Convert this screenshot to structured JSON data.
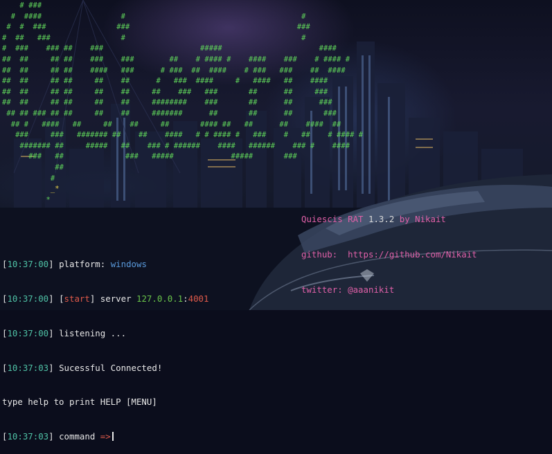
{
  "ascii_art": [
    "    # ###",
    "  #  ####                  #                                        #",
    " #  #  ###                ###                                      ###",
    "#  ##   ###                #                                        #",
    "#  ###    ### ##    ###                      #####                      ####",
    "##  ##     ## ##    ###    ###        ##    # #### #    ####    ###    # #### #",
    "##  ##     ## ##    ####   ###      # ###  ##  ####    # ###   ###    ##  ####",
    "##  ##     ## ##     ##    ##      #   ###  ####     #   ####   ##    ####",
    "##  ##     ## ##     ##    ##     ##    ###   ###       ##      ##     ###",
    "##  ##     ## ##     ##    ##     ########    ###       ##      ##      ###",
    " ## ## ### ## ##     ##    ##     #######      ##       ##      ##       ###",
    "  ## #   ####   ##     ##    ##     ##       #### ##   ##      ##    ####  ##",
    "   ###     ###   ####### ##    ##    ####   # # #### #   ###    #   ##    # #### #",
    "    ####### ##     #####   ##    ### # ######    ####   ######    ### #    ####",
    "      ###   ##              ###   #####             #####       ###",
    "            ##",
    "           #",
    "           _*",
    "          *"
  ],
  "info": {
    "name_prefix": "Quiescis RAT ",
    "version": "1.3.2",
    "by_label": " by Nikait",
    "github_label": "github:  ",
    "github_url": "https://github.com/Nikait",
    "twitter_label": "twitter: ",
    "twitter_handle": "@aaanikit"
  },
  "terminal": {
    "lines": [
      {
        "time": "10:37:00",
        "text": "platform: ",
        "value": "windows"
      },
      {
        "time": "10:37:00",
        "tag": "start",
        "text": "server ",
        "host": "127.0.0.1",
        "sep": ":",
        "port": "4001"
      },
      {
        "time": "10:37:00",
        "text": "listening ..."
      },
      {
        "time": "10:37:03",
        "text": "Sucessful Connected!"
      },
      {
        "plain": "type help to print HELP [MENU]"
      },
      {
        "time": "10:37:03",
        "text": "command ",
        "arrow": "=>"
      }
    ]
  },
  "colors": {
    "ascii": "#5fd35a",
    "timestamp": "#4fc2a6",
    "accent_pink": "#e060a8",
    "platform_value": "#5a9adc",
    "start_tag": "#e05a4a",
    "port": "#e05a4a",
    "arrow": "#e05a4a",
    "host": "#6ac64a"
  }
}
